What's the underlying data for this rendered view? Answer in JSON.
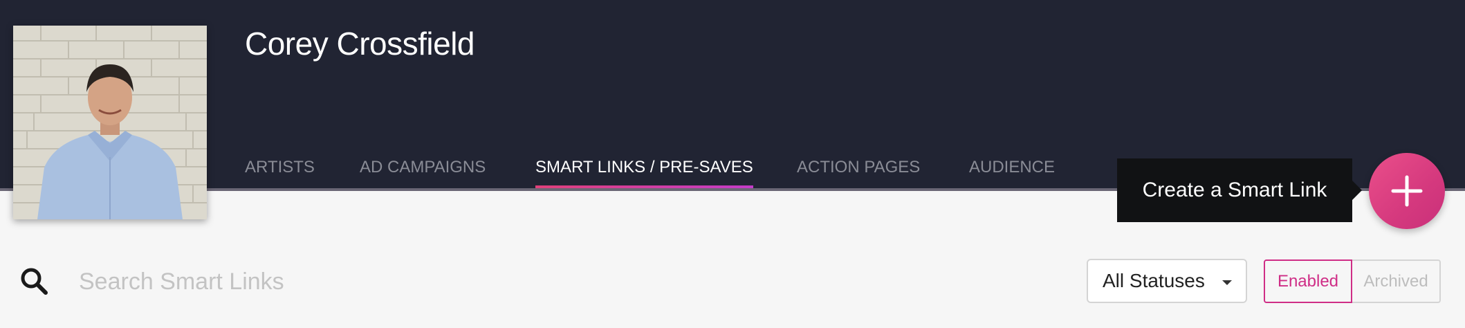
{
  "header": {
    "artist_name": "Corey Crossfield"
  },
  "nav": {
    "tabs": [
      {
        "label": "ARTISTS",
        "active": false
      },
      {
        "label": "AD CAMPAIGNS",
        "active": false
      },
      {
        "label": "SMART LINKS / PRE-SAVES",
        "active": true
      },
      {
        "label": "ACTION PAGES",
        "active": false
      },
      {
        "label": "AUDIENCE",
        "active": false
      }
    ]
  },
  "create_button": {
    "tooltip": "Create a Smart Link",
    "icon": "plus-icon"
  },
  "search": {
    "placeholder": "Search Smart Links",
    "value": "",
    "icon": "search-icon"
  },
  "filters": {
    "status_select": {
      "selected": "All Statuses"
    },
    "toggle": {
      "enabled_label": "Enabled",
      "archived_label": "Archived",
      "selected": "Enabled"
    }
  },
  "colors": {
    "header_bg": "#212433",
    "accent_pink": "#d5397e",
    "accent_purple": "#c33cc8",
    "page_bg": "#f6f6f6"
  }
}
